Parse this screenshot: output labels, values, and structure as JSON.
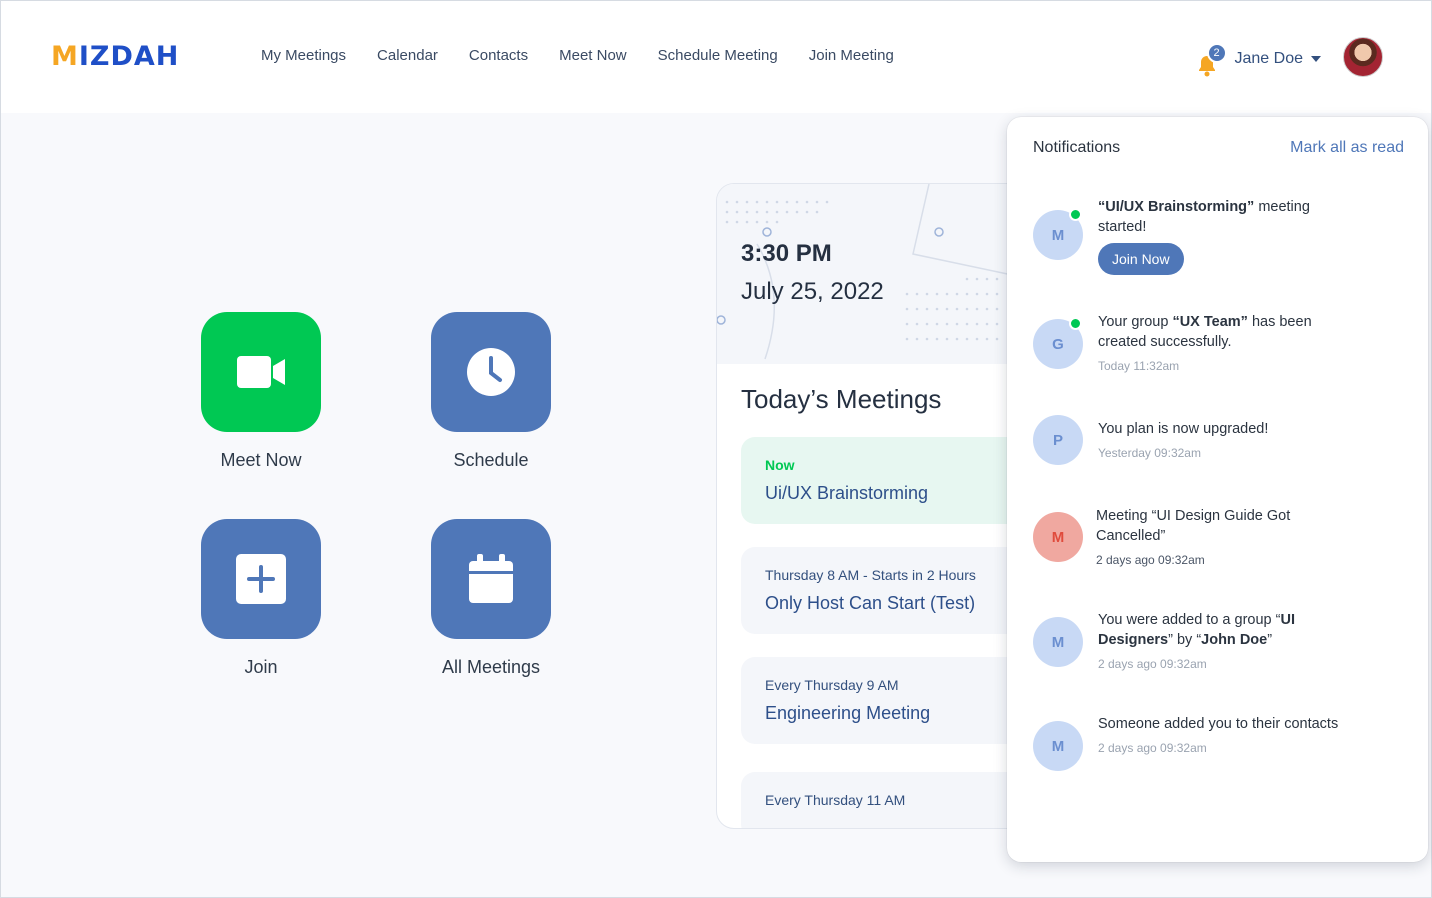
{
  "header": {
    "logo": "MIZDAH",
    "nav": [
      "My Meetings",
      "Calendar",
      "Contacts",
      "Meet Now",
      "Schedule Meeting",
      "Join Meeting"
    ],
    "notification_count": "2",
    "user_name": "Jane Doe"
  },
  "tiles": {
    "meet_now": "Meet Now",
    "schedule": "Schedule",
    "join": "Join",
    "all_meetings": "All Meetings"
  },
  "card": {
    "time": "3:30 PM",
    "date": "July 25, 2022",
    "title": "Today’s Meetings",
    "meetings": [
      {
        "when": "Now",
        "title": "Ui/UX Brainstorming"
      },
      {
        "when": "Thursday 8 AM - Starts in 2 Hours",
        "title": "Only Host Can Start (Test)"
      },
      {
        "when": "Every Thursday 9 AM",
        "title": "Engineering Meeting"
      },
      {
        "when": "Every Thursday 11 AM",
        "title": ""
      }
    ]
  },
  "notifications": {
    "title": "Notifications",
    "mark_all": "Mark all as read",
    "items": [
      {
        "initial": "M",
        "pre": "",
        "bold1": "“UI/UX Brainstorming”",
        "mid": " meeting started!",
        "bold2": "",
        "post": "",
        "time": "",
        "action": "Join Now"
      },
      {
        "initial": "G",
        "pre": "Your group ",
        "bold1": "“UX Team”",
        "mid": " has been created successfully.",
        "bold2": "",
        "post": "",
        "time": "Today 11:32am",
        "action": ""
      },
      {
        "initial": "P",
        "pre": "You plan is now upgraded!",
        "bold1": "",
        "mid": "",
        "bold2": "",
        "post": "",
        "time": "Yesterday 09:32am",
        "action": ""
      },
      {
        "initial": "M",
        "pre": "Meeting “UI Design Guide Got Cancelled”",
        "bold1": "",
        "mid": "",
        "bold2": "",
        "post": "",
        "time": "2 days ago 09:32am",
        "action": ""
      },
      {
        "initial": "M",
        "pre": "You were added to a group “",
        "bold1": "UI Designers",
        "mid": "” by “",
        "bold2": "John Doe",
        "post": "”",
        "time": "2 days ago 09:32am",
        "action": ""
      },
      {
        "initial": "M",
        "pre": "Someone added you to their contacts",
        "bold1": "",
        "mid": "",
        "bold2": "",
        "post": "",
        "time": "2 days ago 09:32am",
        "action": ""
      }
    ]
  },
  "colors": {
    "accent": "#4f77b8",
    "green": "#00c853",
    "brand_blue": "#1f4fc7",
    "brand_orange": "#f5a623"
  }
}
